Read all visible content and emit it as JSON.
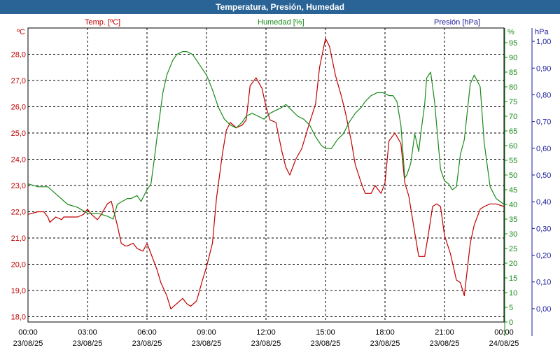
{
  "title": "Temperatura, Presión, Humedad",
  "series_labels": {
    "temp": "Temp. [ºC]",
    "hum": "Humedad [%]",
    "pres": "Presión [hPa]"
  },
  "units": {
    "temp": "ºC",
    "hum": "%",
    "pres": "hPa"
  },
  "colors": {
    "temp": "#c00000",
    "hum": "#1a8a1a",
    "pres": "#1a1a9a",
    "title_bg": "#2a6496",
    "grid": "#000000"
  },
  "chart_data": {
    "type": "line",
    "grid": true,
    "x_ticks": [
      {
        "time": "00:00",
        "date": "23/08/25"
      },
      {
        "time": "03:00",
        "date": "23/08/25"
      },
      {
        "time": "06:00",
        "date": "23/08/25"
      },
      {
        "time": "09:00",
        "date": "23/08/25"
      },
      {
        "time": "12:00",
        "date": "23/08/25"
      },
      {
        "time": "15:00",
        "date": "23/08/25"
      },
      {
        "time": "18:00",
        "date": "23/08/25"
      },
      {
        "time": "21:00",
        "date": "23/08/25"
      },
      {
        "time": "00:00",
        "date": "24/08/25"
      }
    ],
    "x_hours_range": [
      0,
      24
    ],
    "axes": {
      "temp": {
        "min": 17.8,
        "max": 29.0,
        "ticks": [
          "18,0",
          "19,0",
          "20,0",
          "21,0",
          "22,0",
          "23,0",
          "24,0",
          "25,0",
          "26,0",
          "27,0",
          "28,0"
        ],
        "tick_values": [
          18,
          19,
          20,
          21,
          22,
          23,
          24,
          25,
          26,
          27,
          28
        ]
      },
      "hum": {
        "min": 0,
        "max": 100,
        "ticks": [
          "0",
          "5",
          "10",
          "15",
          "20",
          "25",
          "30",
          "35",
          "40",
          "45",
          "50",
          "55",
          "60",
          "65",
          "70",
          "75",
          "80",
          "85",
          "90",
          "95"
        ],
        "tick_values": [
          0,
          5,
          10,
          15,
          20,
          25,
          30,
          35,
          40,
          45,
          50,
          55,
          60,
          65,
          70,
          75,
          80,
          85,
          90,
          95
        ]
      },
      "pres": {
        "min": -0.05,
        "max": 1.05,
        "ticks": [
          "0,00",
          "0,10",
          "0,20",
          "0,30",
          "0,40",
          "0,50",
          "0,60",
          "0,70",
          "0,80",
          "0,90",
          "1,00"
        ],
        "tick_values": [
          0,
          0.1,
          0.2,
          0.3,
          0.4,
          0.5,
          0.6,
          0.7,
          0.8,
          0.9,
          1.0
        ]
      }
    },
    "series": [
      {
        "name": "Temp. [ºC]",
        "axis": "temp",
        "x": [
          0,
          0.5,
          0.8,
          1.0,
          1.1,
          1.4,
          1.7,
          1.8,
          2.0,
          2.5,
          2.8,
          3.0,
          3.2,
          3.5,
          3.7,
          4.0,
          4.2,
          4.5,
          4.7,
          4.9,
          5.0,
          5.3,
          5.5,
          5.8,
          6.0,
          6.2,
          6.5,
          6.7,
          7.0,
          7.2,
          7.5,
          7.8,
          8.0,
          8.2,
          8.5,
          8.8,
          9.0,
          9.3,
          9.5,
          9.8,
          10.0,
          10.2,
          10.5,
          10.8,
          11.0,
          11.2,
          11.5,
          11.8,
          12.0,
          12.2,
          12.5,
          12.8,
          13.0,
          13.2,
          13.5,
          13.8,
          14.0,
          14.2,
          14.5,
          14.7,
          15.0,
          15.2,
          15.5,
          15.8,
          16.0,
          16.3,
          16.5,
          16.8,
          17.0,
          17.3,
          17.5,
          17.8,
          18.0,
          18.2,
          18.5,
          18.8,
          19.0,
          19.2,
          19.5,
          19.7,
          20.0,
          20.2,
          20.4,
          20.6,
          20.8,
          21.0,
          21.3,
          21.6,
          21.8,
          22.0,
          22.3,
          22.5,
          22.8,
          23.0,
          23.3,
          23.6,
          24.0
        ],
        "values": [
          21.9,
          22.0,
          22.0,
          21.8,
          21.6,
          21.8,
          21.7,
          21.8,
          21.8,
          21.8,
          21.9,
          22.1,
          21.9,
          21.7,
          21.9,
          22.3,
          22.4,
          21.5,
          20.8,
          20.7,
          20.7,
          20.8,
          20.6,
          20.5,
          20.8,
          20.4,
          19.8,
          19.3,
          18.8,
          18.3,
          18.5,
          18.7,
          18.5,
          18.4,
          18.6,
          19.4,
          19.9,
          20.8,
          22.5,
          24.2,
          25.1,
          25.4,
          25.2,
          25.3,
          25.5,
          26.8,
          27.1,
          26.7,
          26.0,
          25.5,
          25.4,
          24.3,
          23.7,
          23.4,
          24.0,
          24.4,
          24.9,
          25.4,
          26.1,
          27.5,
          28.6,
          28.3,
          27.2,
          26.4,
          25.8,
          24.7,
          23.8,
          23.1,
          22.7,
          22.7,
          23.0,
          22.7,
          23.1,
          24.7,
          25.0,
          24.6,
          23.1,
          22.6,
          21.2,
          20.3,
          20.3,
          21.2,
          22.2,
          22.3,
          22.2,
          21.1,
          20.4,
          19.4,
          19.3,
          18.8,
          20.8,
          21.5,
          22.1,
          22.2,
          22.3,
          22.3,
          22.2
        ]
      },
      {
        "name": "Humedad [%]",
        "axis": "hum",
        "x": [
          0,
          0.5,
          1.0,
          1.5,
          2.0,
          2.5,
          3.0,
          3.5,
          4.0,
          4.3,
          4.5,
          5.0,
          5.2,
          5.5,
          5.7,
          6.0,
          6.2,
          6.4,
          6.6,
          6.8,
          7.0,
          7.3,
          7.5,
          7.8,
          8.0,
          8.3,
          8.6,
          9.0,
          9.3,
          9.6,
          9.9,
          10.2,
          10.5,
          10.8,
          11.0,
          11.3,
          11.6,
          11.9,
          12.2,
          12.5,
          12.8,
          13.0,
          13.3,
          13.6,
          13.9,
          14.2,
          14.5,
          14.8,
          15.0,
          15.3,
          15.6,
          15.9,
          16.2,
          16.5,
          16.8,
          17.0,
          17.3,
          17.6,
          17.9,
          18.2,
          18.4,
          18.6,
          18.8,
          19.0,
          19.1,
          19.3,
          19.5,
          19.7,
          19.8,
          20.0,
          20.1,
          20.3,
          20.5,
          20.8,
          21.0,
          21.2,
          21.4,
          21.6,
          21.8,
          22.0,
          22.3,
          22.5,
          22.8,
          23.0,
          23.3,
          23.6,
          24.0
        ],
        "values": [
          47,
          46,
          46,
          43,
          40,
          39,
          37,
          37,
          36,
          35,
          40,
          42,
          42,
          43,
          41,
          45,
          47,
          57,
          68,
          78,
          84,
          89,
          91,
          92,
          92,
          91,
          88,
          84,
          79,
          73,
          69,
          67,
          66,
          68,
          70,
          71,
          70,
          69,
          71,
          72,
          73,
          74,
          72,
          70,
          69,
          67,
          63,
          60,
          59,
          59,
          62,
          64,
          68,
          71,
          73,
          75,
          77,
          78,
          78,
          77,
          77,
          75,
          67,
          49,
          50,
          54,
          64,
          58,
          64,
          74,
          83,
          85,
          75,
          52,
          48,
          47,
          45,
          46,
          57,
          62,
          81,
          84,
          80,
          61,
          46,
          42,
          40
        ]
      },
      {
        "name": "Presión [hPa]",
        "axis": "pres",
        "x": [
          0,
          24
        ],
        "values": [
          0.0,
          0.0
        ]
      }
    ]
  }
}
